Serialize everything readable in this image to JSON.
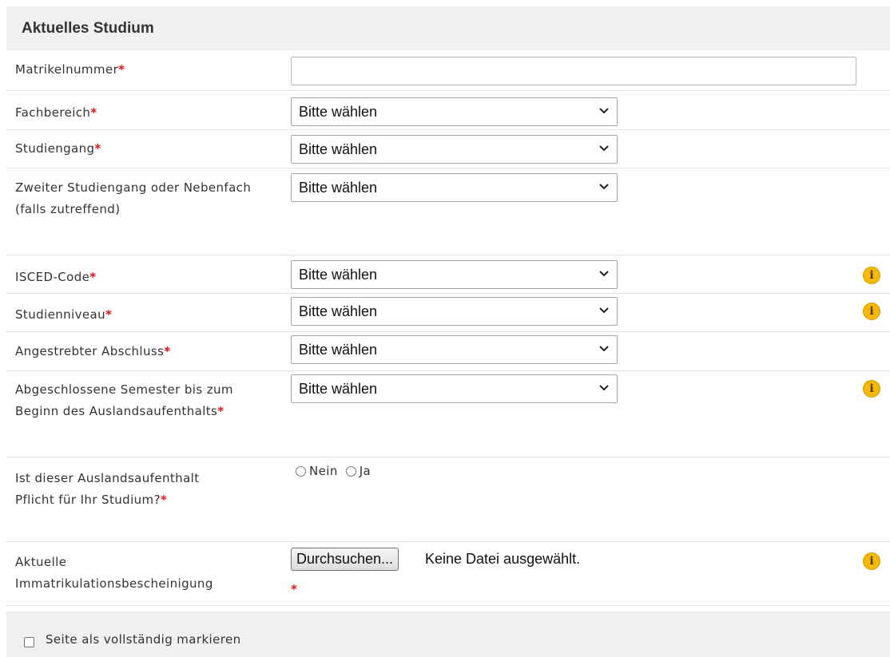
{
  "section": {
    "title": "Aktuelles Studium"
  },
  "required_marker": "*",
  "accent_colors": {
    "required": "#e0131a",
    "info": "#f2b90b"
  },
  "fields": {
    "matrikelnummer": {
      "label": "Matrikelnummer",
      "value": ""
    },
    "fachbereich": {
      "label": "Fachbereich",
      "value": "Bitte wählen"
    },
    "studiengang": {
      "label": "Studiengang",
      "value": "Bitte wählen"
    },
    "zweiter": {
      "label": "Zweiter Studiengang oder Nebenfach (falls zutreffend)",
      "value": "Bitte wählen"
    },
    "isced": {
      "label": "ISCED-Code",
      "value": "Bitte wählen"
    },
    "niveau": {
      "label": "Studienniveau",
      "value": "Bitte wählen"
    },
    "abschluss": {
      "label": "Angestrebter Abschluss",
      "value": "Bitte wählen"
    },
    "semester": {
      "label": "Abgeschlossene Semester bis zum Beginn des Auslandsaufenthalts",
      "value": "Bitte wählen"
    },
    "pflicht": {
      "label": "Ist dieser Auslandsaufenthalt Pflicht für Ihr Studium?",
      "options": [
        "Nein",
        "Ja"
      ]
    },
    "immatrikulation": {
      "label": "Aktuelle Immatrikulationsbescheinigung",
      "button": "Durchsuchen...",
      "status": "Keine Datei ausgewählt."
    }
  },
  "info_icon": "i",
  "footer": {
    "checkbox_label": "Seite als vollständig markieren"
  }
}
